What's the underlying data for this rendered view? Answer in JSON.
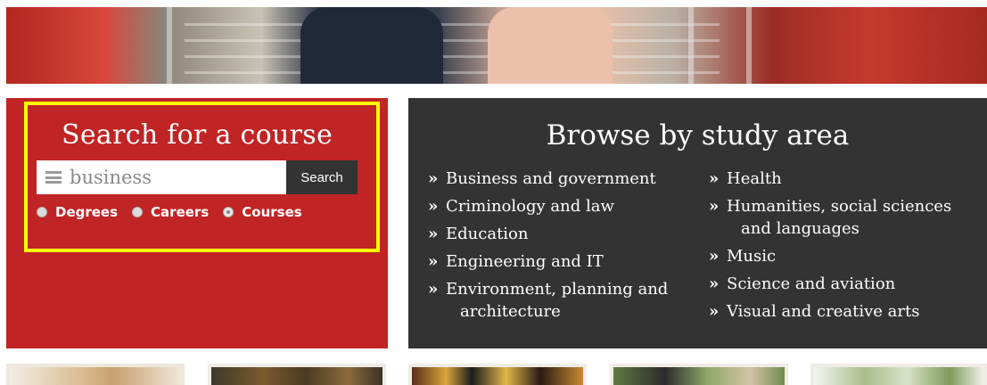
{
  "search": {
    "title": "Search for a course",
    "input_value": "business",
    "button_label": "Search",
    "options": [
      {
        "label": "Degrees",
        "checked": false
      },
      {
        "label": "Careers",
        "checked": false
      },
      {
        "label": "Courses",
        "checked": true
      }
    ]
  },
  "browse": {
    "title": "Browse by study area",
    "arrow": "»",
    "left_items": [
      {
        "label": "Business and government"
      },
      {
        "label": "Criminology and law"
      },
      {
        "label": "Education"
      },
      {
        "label": "Engineering and IT"
      },
      {
        "label": "Environment, planning and",
        "label_cont": "architecture"
      }
    ],
    "right_items": [
      {
        "label": "Health"
      },
      {
        "label": "Humanities, social sciences",
        "label_cont": "and languages"
      },
      {
        "label": "Music"
      },
      {
        "label": "Science and aviation"
      },
      {
        "label": "Visual and creative arts"
      }
    ]
  },
  "colors": {
    "search_bg": "#c02424",
    "browse_bg": "#333333",
    "highlight": "#ffff00",
    "button_bg": "#333333"
  }
}
